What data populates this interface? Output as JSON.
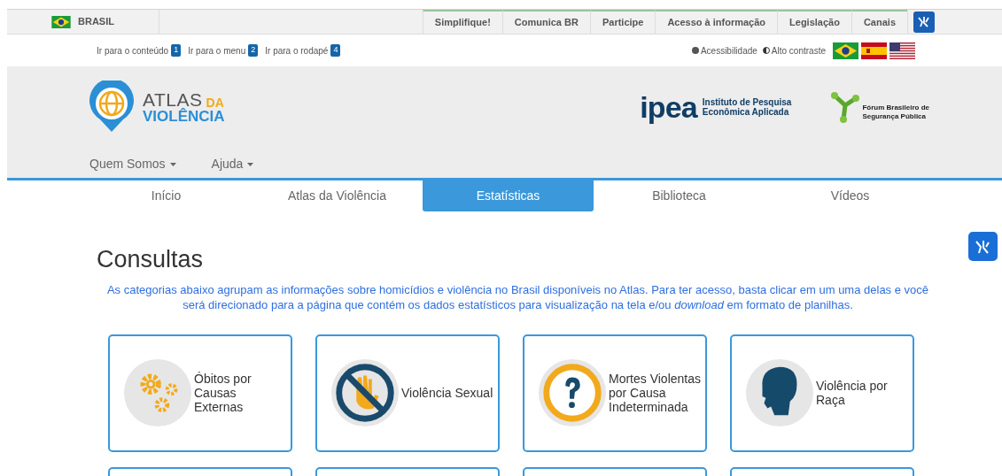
{
  "gov_bar": {
    "country": "BRASIL",
    "links": [
      "Simplifique!",
      "Comunica BR",
      "Participe",
      "Acesso à informação",
      "Legislação",
      "Canais"
    ]
  },
  "accessibility_bar": {
    "skip_links": [
      {
        "label": "Ir para o conteúdo",
        "key": "1"
      },
      {
        "label": "Ir para o menu",
        "key": "2"
      },
      {
        "label": "Ir para o rodapé",
        "key": "4"
      }
    ],
    "options": [
      {
        "kind": "info",
        "label": "Acessibilidade"
      },
      {
        "kind": "contrast",
        "label": "Alto contraste"
      }
    ],
    "languages": [
      {
        "kind": "br"
      },
      {
        "kind": "es"
      },
      {
        "kind": "us"
      }
    ]
  },
  "header": {
    "logo": {
      "word1": "ATLAS",
      "word2": "DA",
      "word3": "VIOLÊNCIA"
    },
    "ipea": {
      "name": "ipea",
      "line1": "Instituto de Pesquisa",
      "line2": "Econômica Aplicada"
    },
    "forum": {
      "line1": "Fórum Brasileiro de",
      "line2": "Segurança Pública"
    },
    "menu": [
      "Quem Somos",
      "Ajuda"
    ]
  },
  "tabs": [
    {
      "label": "Início",
      "selected": false
    },
    {
      "label": "Atlas da Violência",
      "selected": false
    },
    {
      "label": "Estatísticas",
      "selected": true
    },
    {
      "label": "Biblioteca",
      "selected": false
    },
    {
      "label": "Vídeos",
      "selected": false
    }
  ],
  "content": {
    "title": "Consultas",
    "intro": "As categorias abaixo agrupam as informações sobre homicídios e violência no Brasil disponíveis no Atlas. Para ter acesso, basta clicar em um uma delas e você será direcionado para a página que contém os dados estatísticos para visualização na tela e/ou *download* em formato de planilhas.",
    "cards": [
      {
        "kind": "gears",
        "label": "Óbitos por Causas Externas"
      },
      {
        "kind": "no-hand",
        "label": "Violência Sexual"
      },
      {
        "kind": "question",
        "label": "Mortes Violentas por Causa Indeterminada"
      },
      {
        "kind": "head",
        "label": "Violência por Raça"
      }
    ]
  }
}
